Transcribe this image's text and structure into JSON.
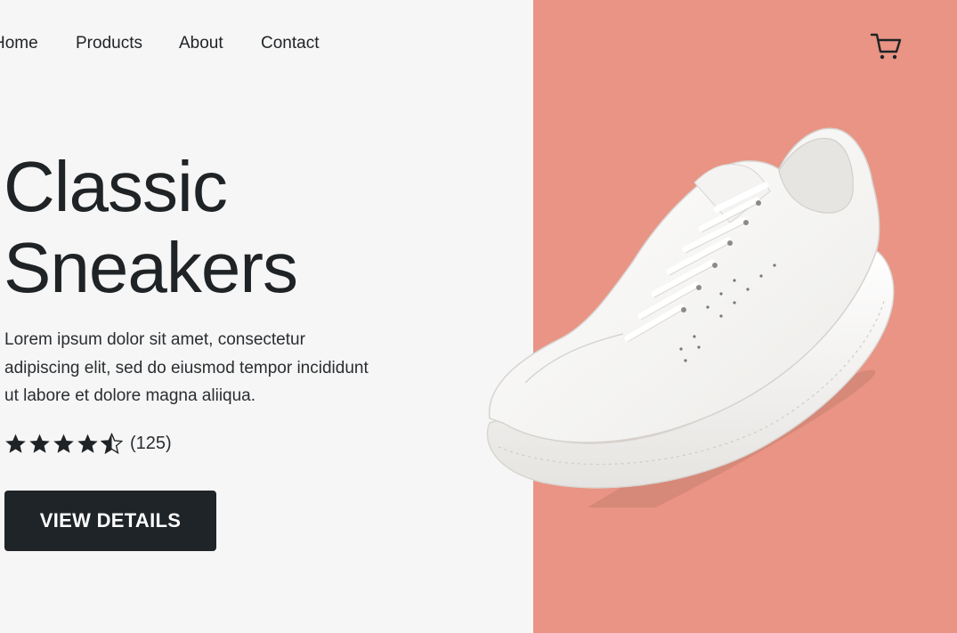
{
  "nav": {
    "items": [
      {
        "label": "Home"
      },
      {
        "label": "Products"
      },
      {
        "label": "About"
      },
      {
        "label": "Contact"
      }
    ],
    "cart_icon": "shopping-cart-icon"
  },
  "hero": {
    "title_line1": "Classic",
    "title_line2": "Sneakers",
    "description": "Lorem ipsum dolor sit amet, consectetur adipiscing elit, sed do eiusmod tempor incididunt ut labore et dolore magna aliiqua.",
    "rating": {
      "value": 4.5,
      "max": 5,
      "count_text": "(125)"
    },
    "cta_label": "VIEW DETAILS"
  },
  "colors": {
    "background": "#f6f6f6",
    "accent_panel": "#e99484",
    "text": "#1f2326",
    "button": "#1f2428"
  }
}
